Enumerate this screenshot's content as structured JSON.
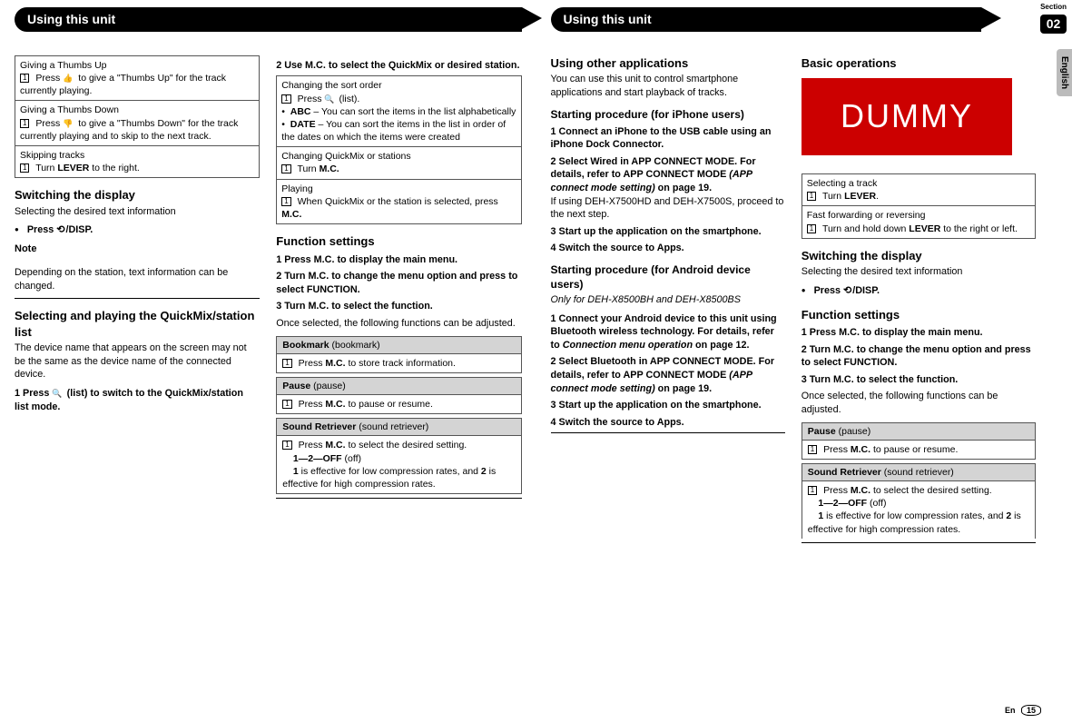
{
  "section": {
    "label": "Section",
    "number": "02"
  },
  "lang": "English",
  "footer": {
    "lang": "En",
    "page": "15"
  },
  "headers": {
    "left": "Using this unit",
    "right": "Using this unit"
  },
  "left": {
    "col1": {
      "table1": {
        "r1_title": "Giving a Thumbs Up",
        "r1_step": "Press ",
        "r1_tail": " to give a \"Thumbs Up\" for the track currently playing.",
        "r2_title": "Giving a Thumbs Down",
        "r2_step": "Press ",
        "r2_tail": " to give a \"Thumbs Down\" for the track currently playing and to skip to the next track.",
        "r3_title": "Skipping tracks",
        "r3_step": "Turn ",
        "r3_bold": "LEVER",
        "r3_tail": " to the right."
      },
      "switching_h": "Switching the display",
      "switching_p": "Selecting the desired text information",
      "press_disp": "Press ",
      "press_disp_b": "/DISP.",
      "note": "Note",
      "note_body": "Depending on the station, text information can be changed.",
      "quickmix_h": "Selecting and playing the QuickMix/station list",
      "quickmix_p": "The device name that appears on the screen may not be the same as the device name of the connected device.",
      "step1": "1    Press ",
      "step1_tail": " (list) to switch to the QuickMix/station list mode."
    },
    "col2": {
      "step2": "2    Use M.C. to select the QuickMix or desired station.",
      "table2": {
        "r1_title": "Changing the sort order",
        "r1_a": "Press ",
        "r1_a_tail": " (list).",
        "r1_abc": "ABC",
        "r1_abc_tail": " – You can sort the items in the list alphabetically",
        "r1_date": "DATE",
        "r1_date_tail": " – You can sort the items in the list in order of the dates on which the items were created",
        "r2_title": "Changing QuickMix or stations",
        "r2_a": "Turn ",
        "r2_b": "M.C.",
        "r3_title": "Playing",
        "r3_a": "When QuickMix or the station is selected, press ",
        "r3_b": "M.C."
      },
      "func_h": "Function settings",
      "fs1": "1    Press M.C. to display the main menu.",
      "fs2": "2    Turn M.C. to change the menu option and press to select FUNCTION.",
      "fs3": "3    Turn M.C. to select the function.",
      "fs3_tail": "Once selected, the following functions can be adjusted.",
      "bookmark_h": "Bookmark ",
      "bookmark_paren": "(bookmark)",
      "bookmark_b": "Press ",
      "bookmark_b2": "M.C.",
      "bookmark_tail": " to store track information.",
      "pause_h": "Pause ",
      "pause_paren": "(pause)",
      "pause_b": "Press ",
      "pause_b2": "M.C.",
      "pause_tail": " to pause or resume.",
      "sr_h": "Sound Retriever ",
      "sr_paren": "(sound retriever)",
      "sr_b": "Press ",
      "sr_b2": "M.C.",
      "sr_tail": " to select the desired setting.",
      "sr_opts": "1—2—OFF",
      "sr_opts_tail": " (off)",
      "sr_note": "1",
      "sr_note_mid": " is effective for low compression rates, and ",
      "sr_note2": "2",
      "sr_note_tail": " is effective for high compression rates."
    }
  },
  "right": {
    "col1": {
      "other_h": "Using other applications",
      "other_p": "You can use this unit to control smartphone applications and start playback of tracks.",
      "iphone_h": "Starting procedure (for iPhone users)",
      "ip1": "1    Connect an iPhone to the USB cable using an iPhone Dock Connector.",
      "ip2a": "2    Select Wired in APP CONNECT MODE. For details, refer to APP CONNECT MODE ",
      "ip2b": "(APP connect mode setting)",
      "ip2c": " on page 19.",
      "ip2_tail": "If using DEH-X7500HD and DEH-X7500S, proceed to the next step.",
      "ip3": "3    Start up the application on the smartphone.",
      "ip4": "4    Switch the source to Apps.",
      "android_h": "Starting procedure (for Android device users)",
      "android_note": "Only for DEH-X8500BH and DEH-X8500BS",
      "an1a": "1    Connect your Android device to this unit using Bluetooth wireless technology. For details, refer to ",
      "an1b": "Connection menu operation",
      "an1c": " on page 12.",
      "an2a": "2    Select Bluetooth in APP CONNECT MODE. For details, refer to APP CONNECT MODE ",
      "an2b": "(APP connect mode setting)",
      "an2c": " on page 19.",
      "an3": "3    Start up the application on the smartphone.",
      "an4": "4    Switch the source to Apps."
    },
    "col2": {
      "basic_h": "Basic operations",
      "dummy": "DUMMY",
      "table": {
        "r1_title": "Selecting a track",
        "r1_a": "Turn ",
        "r1_b": "LEVER",
        "r1_c": ".",
        "r2_title": "Fast forwarding or reversing",
        "r2_a": "Turn and hold down ",
        "r2_b": "LEVER",
        "r2_c": " to the right or left."
      },
      "switching_h": "Switching the display",
      "switching_p": "Selecting the desired text information",
      "press_disp": "Press ",
      "press_disp_b": "/DISP.",
      "func_h": "Function settings",
      "fs1": "1    Press M.C. to display the main menu.",
      "fs2": "2    Turn M.C. to change the menu option and press to select FUNCTION.",
      "fs3": "3    Turn M.C. to select the function.",
      "fs3_tail": "Once selected, the following functions can be adjusted.",
      "pause_h": "Pause ",
      "pause_paren": "(pause)",
      "pause_b": "Press ",
      "pause_b2": "M.C.",
      "pause_tail": " to pause or resume.",
      "sr_h": "Sound Retriever ",
      "sr_paren": "(sound retriever)",
      "sr_b": "Press ",
      "sr_b2": "M.C.",
      "sr_tail": " to select the desired setting.",
      "sr_opts": "1—2—OFF",
      "sr_opts_tail": " (off)",
      "sr_note": "1",
      "sr_note_mid": " is effective for low compression rates, and ",
      "sr_note2": "2",
      "sr_note_tail": " is effective for high compression rates."
    }
  }
}
